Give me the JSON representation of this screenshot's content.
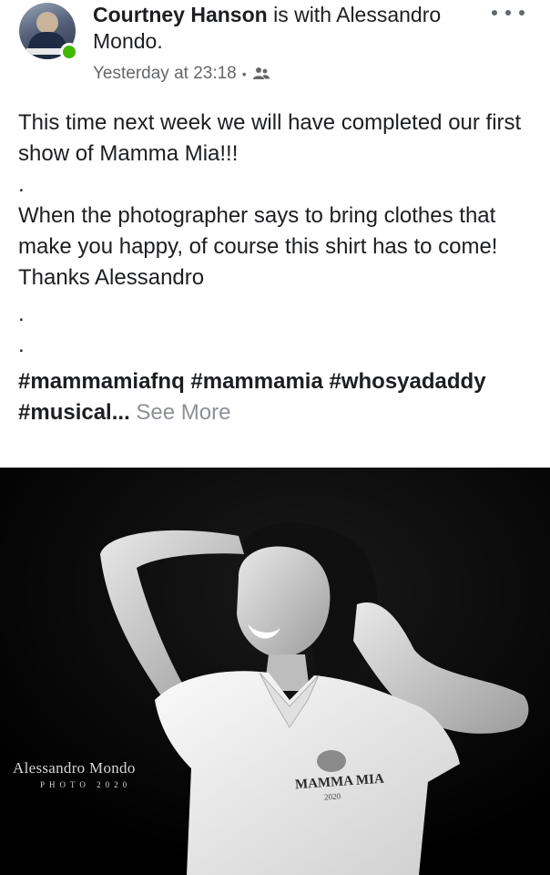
{
  "header": {
    "author": "Courtney Hanson",
    "with_text": " is with ",
    "tagged": "Alessandro Mondo.",
    "timestamp": "Yesterday at 23:18",
    "separator": "•",
    "audience_icon": "friends-icon",
    "more_icon": "more-options-icon",
    "online_color": "#44b700"
  },
  "post": {
    "line1": "This time next week we will have completed our first show of Mamma Mia!!!",
    "dot1": ".",
    "paragraph2": "When the photographer says to bring clothes that make you happy, of course this shirt has to come!",
    "line3": "Thanks Alessandro",
    "dot2": ".",
    "dot3": ".",
    "hashtags": "#mammamiafnq #mammamia #whosyadaddy #musical...",
    "see_more": " See More"
  },
  "photo": {
    "watermark_name": "Alessandro Mondo",
    "watermark_sub": "PHOTO 2020",
    "shirt_text": "MAMMA MIA",
    "shirt_year": "2020"
  }
}
